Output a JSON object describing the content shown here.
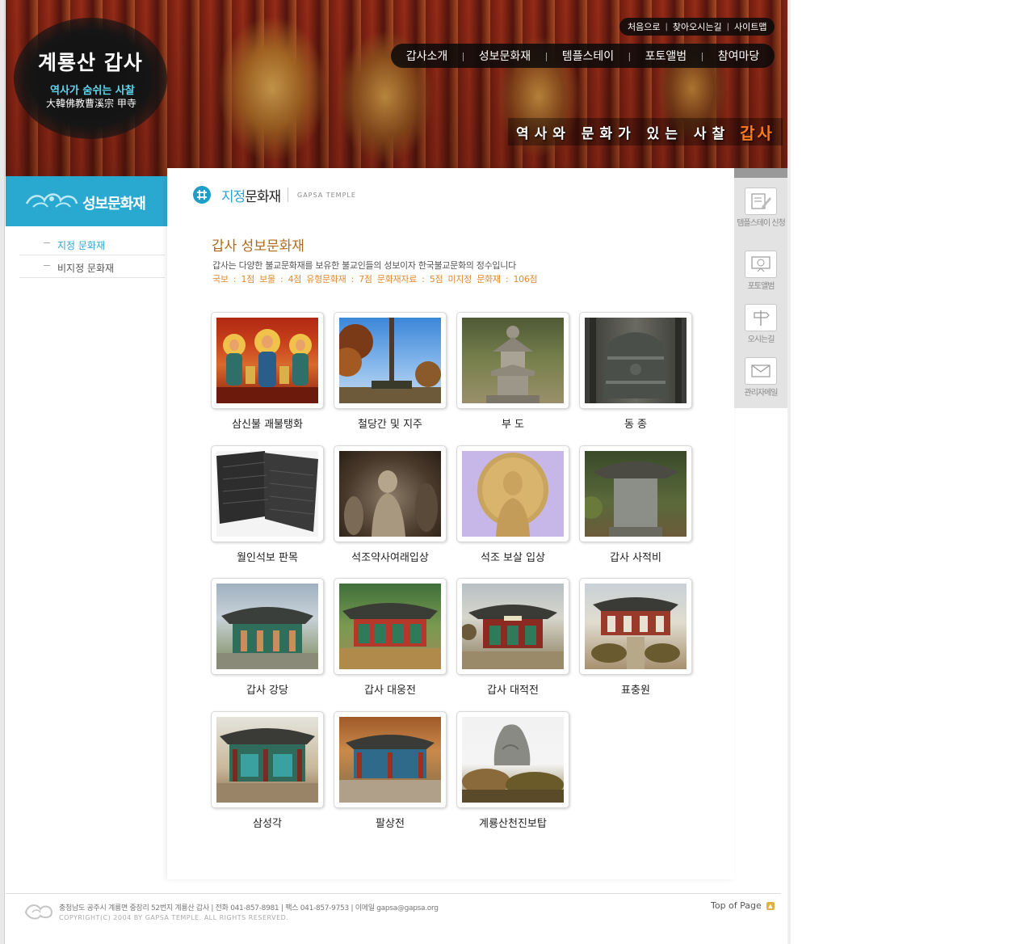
{
  "banner": {
    "logo_title": "계룡산 갑사",
    "logo_subtitle": "역사가 숨쉬는 사찰",
    "logo_hanja": "大韓佛教曹溪宗 甲寺",
    "slogan": "역사와 문화가 있는 사찰",
    "slogan_accent": "갑사"
  },
  "util_links": [
    "처음으로",
    "찾아오시는길",
    "사이트맵"
  ],
  "gnb": [
    "갑사소개",
    "성보문화재",
    "템플스테이",
    "포토앨범",
    "참여마당"
  ],
  "sidebar": {
    "title": "성보문화재",
    "items": [
      {
        "label": "지정 문화재",
        "active": true
      },
      {
        "label": "비지정 문화재",
        "active": false
      }
    ]
  },
  "page_header": {
    "title_accent": "지정",
    "title_rest": "문화재",
    "english": "GAPSA TEMPLE"
  },
  "intro": {
    "title": "갑사 성보문화재",
    "text": "갑사는 다양한 불교문화재를 보유한 불교인들의 성보이자 한국불교문화의 정수입니다",
    "counts": "국보 : 1점  보물 : 4점  유형문화재 : 7점  문화재자료 : 5점  미지정 문화재 : 106점"
  },
  "gallery": [
    {
      "caption": "삼신불 괘불탱화",
      "thumb": "buddha-painting"
    },
    {
      "caption": "철당간 및 지주",
      "thumb": "iron-flagpole"
    },
    {
      "caption": "부 도",
      "thumb": "stupa"
    },
    {
      "caption": "동 종",
      "thumb": "bronze-bell"
    },
    {
      "caption": "월인석보 판목",
      "thumb": "woodblock"
    },
    {
      "caption": "석조약사여래입상",
      "thumb": "stone-buddha-cave"
    },
    {
      "caption": "석조 보살 입상",
      "thumb": "stone-bodhisattva"
    },
    {
      "caption": "갑사 사적비",
      "thumb": "stele-pavilion"
    },
    {
      "caption": "갑사 강당",
      "thumb": "hall-lecture"
    },
    {
      "caption": "갑사 대웅전",
      "thumb": "hall-main"
    },
    {
      "caption": "갑사 대적전",
      "thumb": "hall-daejeok"
    },
    {
      "caption": "표충원",
      "thumb": "hall-pyochung"
    },
    {
      "caption": "삼성각",
      "thumb": "hall-samseong"
    },
    {
      "caption": "팔상전",
      "thumb": "hall-palsang"
    },
    {
      "caption": "계룡산천진보탑",
      "thumb": "rock-pagoda"
    }
  ],
  "quick_menu": [
    {
      "label": "템플스테이 신청",
      "icon": "pencil-form-icon"
    },
    {
      "label": "포토앨범",
      "icon": "photo-icon"
    },
    {
      "label": "오시는길",
      "icon": "signpost-icon"
    },
    {
      "label": "관리자메일",
      "icon": "mail-icon"
    }
  ],
  "footer": {
    "address": "충청남도 공주시 계룡면 중장리 52번지  계룡산 갑사  |  전화 041-857-8981  |  팩스 041-857-9753  |  이메일 gapsa@gapsa.org",
    "copyright": "COPYRIGHT(C) 2004 BY GAPSA TEMPLE. ALL RIGHTS RESERVED.",
    "top_of_page": "Top of Page"
  },
  "colors": {
    "accent_blue": "#29a9cf",
    "accent_orange": "#e08a30",
    "title_brown": "#b06a1c"
  }
}
